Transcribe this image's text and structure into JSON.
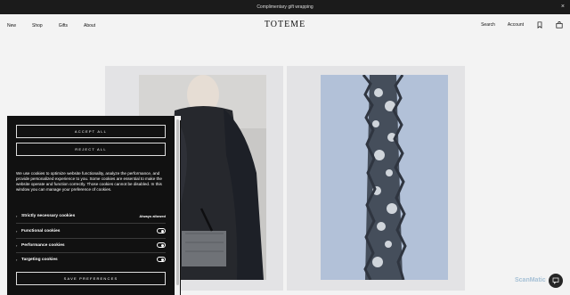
{
  "announcement": {
    "text": "Complimentary gift wrapping",
    "close_icon": "×"
  },
  "header": {
    "logo": "TOTEME",
    "nav_left": [
      "New",
      "Shop",
      "Gifts",
      "About"
    ],
    "search_label": "Search",
    "account_label": "Account",
    "wishlist_icon": "bookmark-icon",
    "bag_icon": "bag-icon"
  },
  "cookie_banner": {
    "accept_label": "ACCEPT ALL",
    "reject_label": "REJECT ALL",
    "description": "We use cookies to optimize website functionality, analyze the performance, and provide personalized experience to you. Some cookies are essential to make the website operate and function correctly. Those cookies cannot be disabled. In this window you can manage your preference of cookies.",
    "categories": [
      {
        "label": "Strictly necessary cookies",
        "status": "Always allowed"
      },
      {
        "label": "Functional cookies",
        "enabled": true
      },
      {
        "label": "Performance cookies",
        "enabled": true
      },
      {
        "label": "Targeting cookies",
        "enabled": true
      }
    ],
    "save_label": "SAVE PREFERENCES"
  },
  "watermark": "ScanMatic",
  "colors": {
    "announcement_bg": "#1b1b1b",
    "page_bg": "#f3f3f3",
    "banner_bg": "#111111",
    "panel_bg": "#e3e3e5"
  }
}
